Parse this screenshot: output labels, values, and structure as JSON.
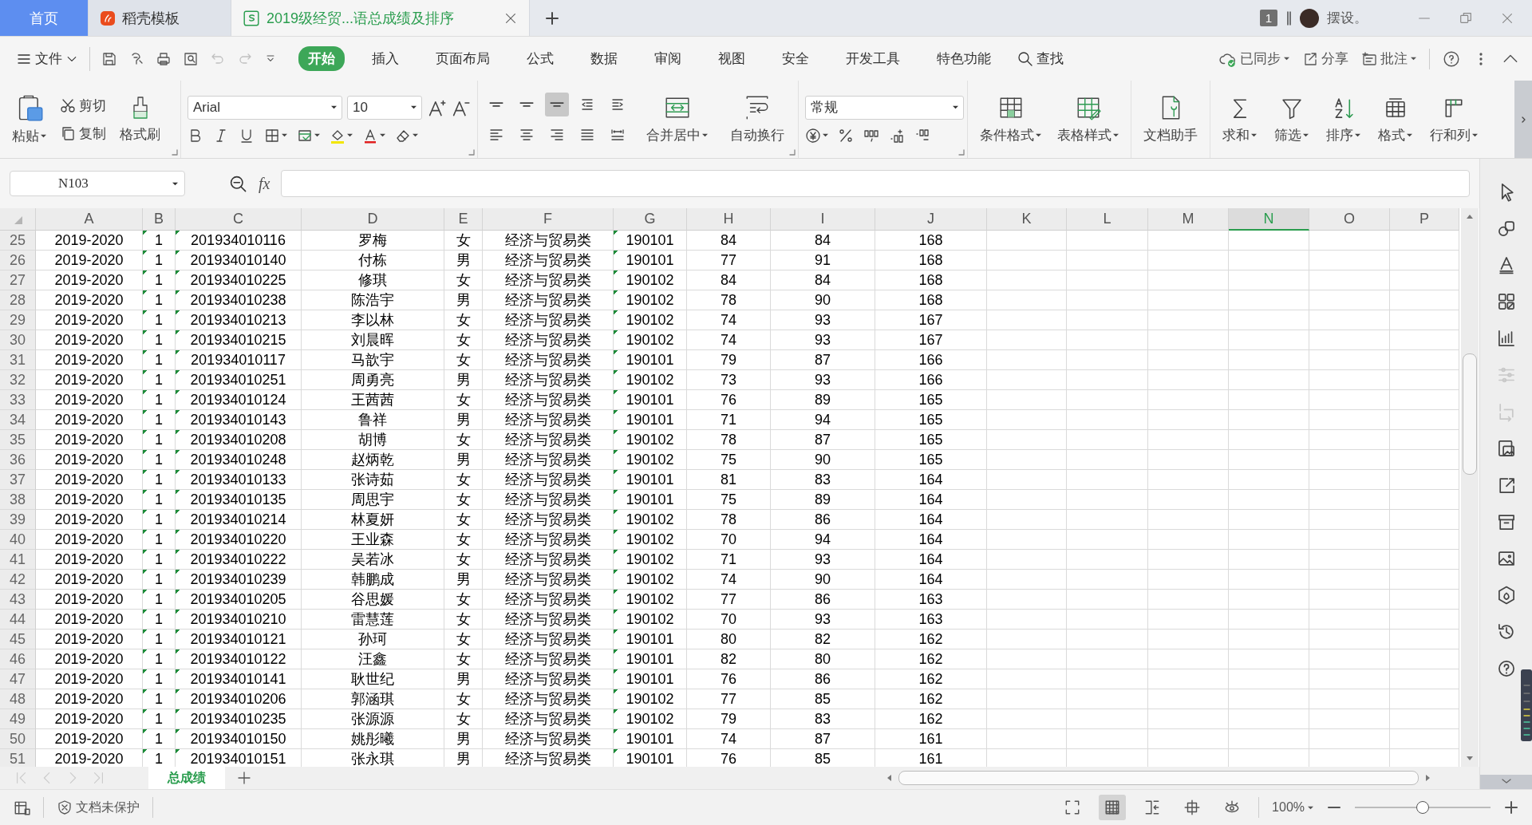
{
  "tabs": [
    {
      "label": "首页",
      "kind": "home",
      "selected": false
    },
    {
      "label": "稻壳模板",
      "kind": "template",
      "selected": false
    },
    {
      "label": "2019级经贸...语总成绩及排序",
      "kind": "sheet",
      "selected": true
    }
  ],
  "account": {
    "badge": "1",
    "user": "摆设。"
  },
  "menu": {
    "file": "文件",
    "tabs": [
      {
        "label": "开始",
        "selected": true
      },
      {
        "label": "插入",
        "selected": false
      },
      {
        "label": "页面布局",
        "selected": false
      },
      {
        "label": "公式",
        "selected": false
      },
      {
        "label": "数据",
        "selected": false
      },
      {
        "label": "审阅",
        "selected": false
      },
      {
        "label": "视图",
        "selected": false
      },
      {
        "label": "安全",
        "selected": false
      },
      {
        "label": "开发工具",
        "selected": false
      },
      {
        "label": "特色功能",
        "selected": false
      }
    ],
    "search": "查找",
    "sync": "已同步",
    "share": "分享",
    "comment": "批注"
  },
  "ribbon": {
    "paste": "粘贴",
    "cut": "剪切",
    "copy": "复制",
    "format_painter": "格式刷",
    "font_name": "Arial",
    "font_size": "10",
    "align_buttons": [
      {
        "selected": false
      },
      {
        "selected": false
      },
      {
        "selected": true
      },
      {
        "selected": false
      },
      {
        "selected": false
      },
      {
        "selected": false
      },
      {
        "selected": false
      },
      {
        "selected": false
      },
      {
        "selected": false
      },
      {
        "selected": false
      }
    ],
    "merge": "合并居中",
    "wrap": "自动换行",
    "number_format": "常规",
    "styles": [
      {
        "label": "条件格式"
      },
      {
        "label": "表格样式"
      }
    ],
    "assistant": "文档助手",
    "editing": [
      {
        "label": "求和"
      },
      {
        "label": "筛选"
      },
      {
        "label": "排序"
      },
      {
        "label": "格式"
      },
      {
        "label": "行和列"
      }
    ]
  },
  "formula_bar": {
    "cell_ref": "N103",
    "fx": "fx"
  },
  "columns": [
    {
      "label": "A",
      "selected": false
    },
    {
      "label": "B",
      "selected": false
    },
    {
      "label": "C",
      "selected": false
    },
    {
      "label": "D",
      "selected": false
    },
    {
      "label": "E",
      "selected": false
    },
    {
      "label": "F",
      "selected": false
    },
    {
      "label": "G",
      "selected": false
    },
    {
      "label": "H",
      "selected": false
    },
    {
      "label": "I",
      "selected": false
    },
    {
      "label": "J",
      "selected": false
    },
    {
      "label": "K",
      "selected": false
    },
    {
      "label": "L",
      "selected": false
    },
    {
      "label": "M",
      "selected": false
    },
    {
      "label": "N",
      "selected": true
    },
    {
      "label": "O",
      "selected": false
    },
    {
      "label": "P",
      "selected": false
    }
  ],
  "rows": [
    {
      "row": "25",
      "cells": [
        "2019-2020",
        "1",
        "201934010116",
        "罗梅",
        "女",
        "经济与贸易类",
        "190101",
        "84",
        "84",
        "168"
      ]
    },
    {
      "row": "26",
      "cells": [
        "2019-2020",
        "1",
        "201934010140",
        "付栋",
        "男",
        "经济与贸易类",
        "190101",
        "77",
        "91",
        "168"
      ]
    },
    {
      "row": "27",
      "cells": [
        "2019-2020",
        "1",
        "201934010225",
        "修琪",
        "女",
        "经济与贸易类",
        "190102",
        "84",
        "84",
        "168"
      ]
    },
    {
      "row": "28",
      "cells": [
        "2019-2020",
        "1",
        "201934010238",
        "陈浩宇",
        "男",
        "经济与贸易类",
        "190102",
        "78",
        "90",
        "168"
      ]
    },
    {
      "row": "29",
      "cells": [
        "2019-2020",
        "1",
        "201934010213",
        "李以林",
        "女",
        "经济与贸易类",
        "190102",
        "74",
        "93",
        "167"
      ]
    },
    {
      "row": "30",
      "cells": [
        "2019-2020",
        "1",
        "201934010215",
        "刘晨晖",
        "女",
        "经济与贸易类",
        "190102",
        "74",
        "93",
        "167"
      ]
    },
    {
      "row": "31",
      "cells": [
        "2019-2020",
        "1",
        "201934010117",
        "马歆宇",
        "女",
        "经济与贸易类",
        "190101",
        "79",
        "87",
        "166"
      ]
    },
    {
      "row": "32",
      "cells": [
        "2019-2020",
        "1",
        "201934010251",
        "周勇亮",
        "男",
        "经济与贸易类",
        "190102",
        "73",
        "93",
        "166"
      ]
    },
    {
      "row": "33",
      "cells": [
        "2019-2020",
        "1",
        "201934010124",
        "王茜茜",
        "女",
        "经济与贸易类",
        "190101",
        "76",
        "89",
        "165"
      ]
    },
    {
      "row": "34",
      "cells": [
        "2019-2020",
        "1",
        "201934010143",
        "鲁祥",
        "男",
        "经济与贸易类",
        "190101",
        "71",
        "94",
        "165"
      ]
    },
    {
      "row": "35",
      "cells": [
        "2019-2020",
        "1",
        "201934010208",
        "胡博",
        "女",
        "经济与贸易类",
        "190102",
        "78",
        "87",
        "165"
      ]
    },
    {
      "row": "36",
      "cells": [
        "2019-2020",
        "1",
        "201934010248",
        "赵炳乾",
        "男",
        "经济与贸易类",
        "190102",
        "75",
        "90",
        "165"
      ]
    },
    {
      "row": "37",
      "cells": [
        "2019-2020",
        "1",
        "201934010133",
        "张诗茹",
        "女",
        "经济与贸易类",
        "190101",
        "81",
        "83",
        "164"
      ]
    },
    {
      "row": "38",
      "cells": [
        "2019-2020",
        "1",
        "201934010135",
        "周思宇",
        "女",
        "经济与贸易类",
        "190101",
        "75",
        "89",
        "164"
      ]
    },
    {
      "row": "39",
      "cells": [
        "2019-2020",
        "1",
        "201934010214",
        "林夏妍",
        "女",
        "经济与贸易类",
        "190102",
        "78",
        "86",
        "164"
      ]
    },
    {
      "row": "40",
      "cells": [
        "2019-2020",
        "1",
        "201934010220",
        "王业森",
        "女",
        "经济与贸易类",
        "190102",
        "70",
        "94",
        "164"
      ]
    },
    {
      "row": "41",
      "cells": [
        "2019-2020",
        "1",
        "201934010222",
        "吴若冰",
        "女",
        "经济与贸易类",
        "190102",
        "71",
        "93",
        "164"
      ]
    },
    {
      "row": "42",
      "cells": [
        "2019-2020",
        "1",
        "201934010239",
        "韩鹏成",
        "男",
        "经济与贸易类",
        "190102",
        "74",
        "90",
        "164"
      ]
    },
    {
      "row": "43",
      "cells": [
        "2019-2020",
        "1",
        "201934010205",
        "谷思媛",
        "女",
        "经济与贸易类",
        "190102",
        "77",
        "86",
        "163"
      ]
    },
    {
      "row": "44",
      "cells": [
        "2019-2020",
        "1",
        "201934010210",
        "雷慧莲",
        "女",
        "经济与贸易类",
        "190102",
        "70",
        "93",
        "163"
      ]
    },
    {
      "row": "45",
      "cells": [
        "2019-2020",
        "1",
        "201934010121",
        "孙珂",
        "女",
        "经济与贸易类",
        "190101",
        "80",
        "82",
        "162"
      ]
    },
    {
      "row": "46",
      "cells": [
        "2019-2020",
        "1",
        "201934010122",
        "汪鑫",
        "女",
        "经济与贸易类",
        "190101",
        "82",
        "80",
        "162"
      ]
    },
    {
      "row": "47",
      "cells": [
        "2019-2020",
        "1",
        "201934010141",
        "耿世纪",
        "男",
        "经济与贸易类",
        "190101",
        "76",
        "86",
        "162"
      ]
    },
    {
      "row": "48",
      "cells": [
        "2019-2020",
        "1",
        "201934010206",
        "郭涵琪",
        "女",
        "经济与贸易类",
        "190102",
        "77",
        "85",
        "162"
      ]
    },
    {
      "row": "49",
      "cells": [
        "2019-2020",
        "1",
        "201934010235",
        "张源源",
        "女",
        "经济与贸易类",
        "190102",
        "79",
        "83",
        "162"
      ]
    },
    {
      "row": "50",
      "cells": [
        "2019-2020",
        "1",
        "201934010150",
        "姚彤曦",
        "男",
        "经济与贸易类",
        "190101",
        "74",
        "87",
        "161"
      ]
    },
    {
      "row": "51",
      "cells": [
        "2019-2020",
        "1",
        "201934010151",
        "张永琪",
        "男",
        "经济与贸易类",
        "190101",
        "76",
        "85",
        "161"
      ]
    }
  ],
  "sheet_tabs": [
    {
      "label": "总成绩",
      "selected": true
    }
  ],
  "status": {
    "protection": "文档未保护",
    "views": [
      {
        "selected": false
      },
      {
        "selected": true
      },
      {
        "selected": false
      },
      {
        "selected": false
      },
      {
        "selected": false
      }
    ],
    "zoom": "100%",
    "level": 0.5
  }
}
